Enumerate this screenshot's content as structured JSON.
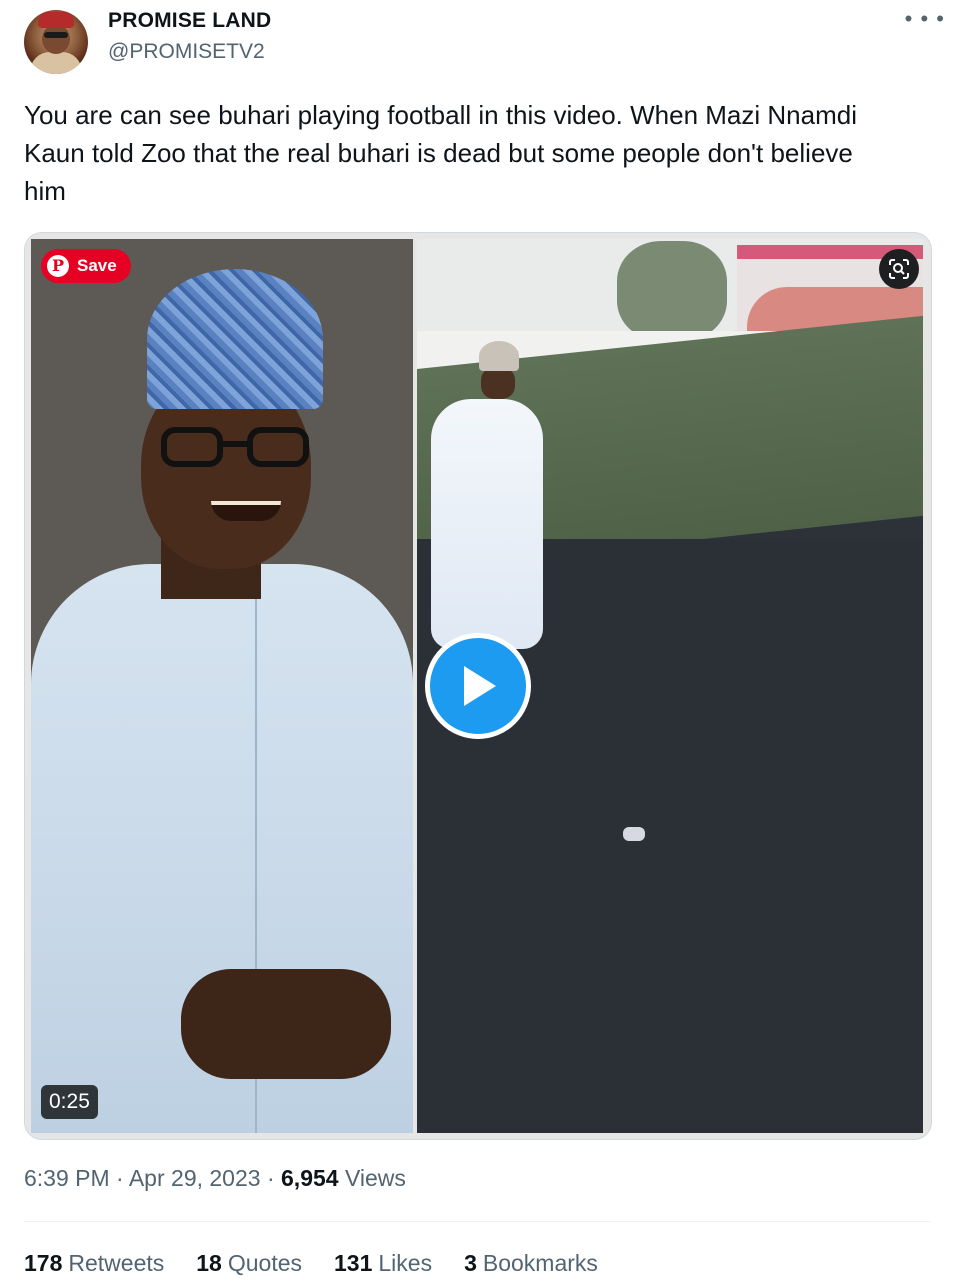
{
  "author": {
    "name": "PROMISE LAND",
    "handle": "@PROMISETV2"
  },
  "more_icon": "more-horizontal-icon",
  "tweet": {
    "text": "You are can see buhari playing football in this video. When Mazi Nnamdi\nKaun told Zoo that the real buhari is dead but some people don't believe\nhim"
  },
  "media": {
    "save_label": "Save",
    "duration": "0:25",
    "play_icon": "play-icon",
    "lens_icon": "visual-search-icon",
    "accent_color": "#1d9bf0",
    "save_color": "#e60023"
  },
  "meta": {
    "time": "6:39 PM",
    "date": "Apr 29, 2023",
    "views_count": "6,954",
    "views_label": "Views",
    "sep": "·"
  },
  "stats": [
    {
      "count": "178",
      "label": "Retweets"
    },
    {
      "count": "18",
      "label": "Quotes"
    },
    {
      "count": "131",
      "label": "Likes"
    },
    {
      "count": "3",
      "label": "Bookmarks"
    }
  ]
}
